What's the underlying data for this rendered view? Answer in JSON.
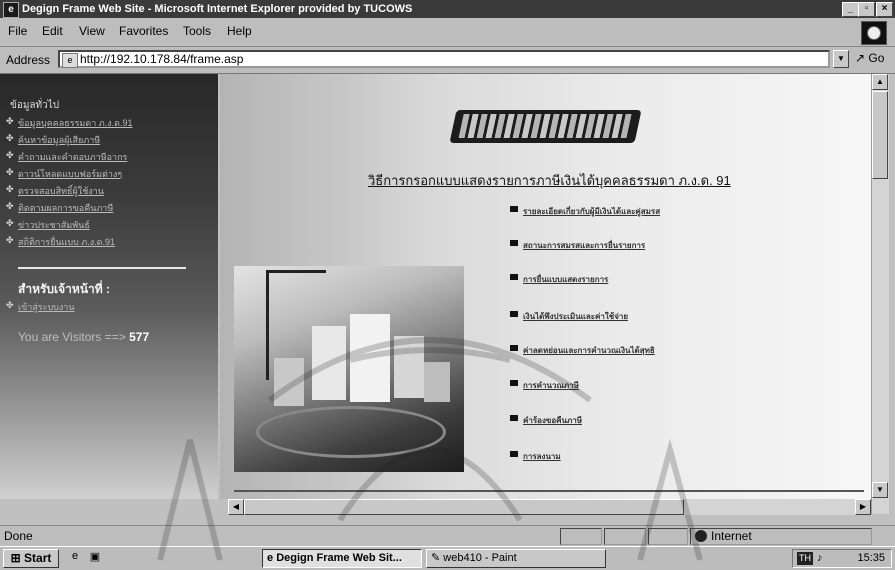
{
  "window": {
    "title": "Degign Frame Web Site - Microsoft Internet Explorer provided by TUCOWS",
    "app_icon": "ie-icon",
    "controls": [
      "_",
      "▫",
      "×"
    ]
  },
  "menu": [
    "File",
    "Edit",
    "View",
    "Favorites",
    "Tools",
    "Help"
  ],
  "address": {
    "label": "Address",
    "url": "http://192.10.178.84/frame.asp",
    "go_label": "Go"
  },
  "sidebar": {
    "heading": "ข้อมูลทั่วไป",
    "links": [
      "ข้อมูลบุคคลธรรมดา ภ.ง.ด.91",
      "ค้นหาข้อมูลผู้เสียภาษี",
      "คำถามและคำตอบภาษีอากร",
      "ดาวน์โหลดแบบฟอร์มต่างๆ",
      "ตรวจสอบสิทธิ์ผู้ใช้งาน",
      "ติดตามผลการขอคืนภาษี",
      "ข่าวประชาสัมพันธ์",
      "สถิติการยื่นแบบ ภ.ง.ด.91"
    ],
    "staff_title": "สำหรับเจ้าหน้าที่ :",
    "staff_link": "เข้าสู่ระบบงาน",
    "visitors_label": "You are Visitors ==>",
    "visitors_count": "577"
  },
  "main": {
    "banner_text": "กรมสรรพากร",
    "page_title": "วิธีการกรอกแบบแสดงรายการภาษีเงินได้บุคคลธรรมดา ภ.ง.ด. 91",
    "items": [
      "รายละเอียดเกี่ยวกับผู้มีเงินได้และคู่สมรส",
      "สถานะการสมรสและการยื่นรายการ",
      "การยื่นแบบแสดงรายการ",
      "เงินได้พึงประเมินและค่าใช้จ่าย",
      "ค่าลดหย่อนและการคำนวณเงินได้สุทธิ",
      "การคำนวณภาษี",
      "คำร้องขอคืนภาษี",
      "การลงนาม"
    ]
  },
  "status": {
    "text": "Done",
    "zone": "Internet"
  },
  "taskbar": {
    "start": "Start",
    "tasks": [
      "Degign Frame Web Sit...",
      "web410 - Paint"
    ],
    "clock": "15:35",
    "tray_badge": "TH"
  }
}
